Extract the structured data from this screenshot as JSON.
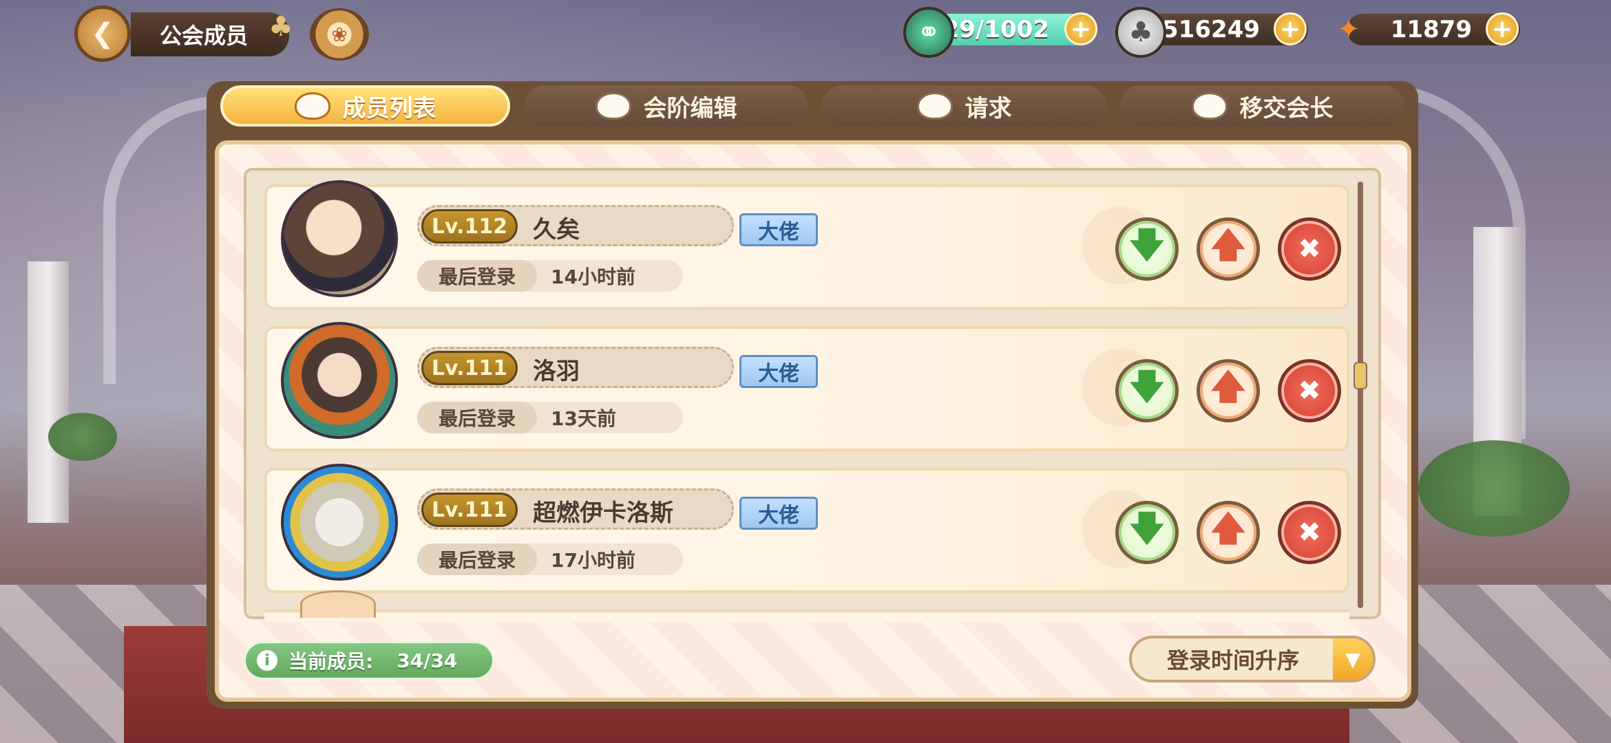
{
  "header": {
    "title": "公会成员",
    "back_icon": "back-arrow-icon",
    "emblem_icon": "guild-emblem-icon"
  },
  "resources": [
    {
      "icon": "potion-icon",
      "value": "29/1002"
    },
    {
      "icon": "clover-coin-icon",
      "value": "6516249"
    },
    {
      "icon": "carrot-icon",
      "value": "11879"
    }
  ],
  "tabs": [
    {
      "label": "成员列表",
      "active": true
    },
    {
      "label": "会阶编辑",
      "active": false
    },
    {
      "label": "请求",
      "active": false
    },
    {
      "label": "移交会长",
      "active": false
    }
  ],
  "members": [
    {
      "level": "Lv.112",
      "name": "久矣",
      "rank": "大佬",
      "login_label": "最后登录",
      "login_time": "14小时前"
    },
    {
      "level": "Lv.111",
      "name": "洛羽",
      "rank": "大佬",
      "login_label": "最后登录",
      "login_time": "13天前"
    },
    {
      "level": "Lv.111",
      "name": "超燃伊卡洛斯",
      "rank": "大佬",
      "login_label": "最后登录",
      "login_time": "17小时前"
    }
  ],
  "footer": {
    "member_count_label": "当前成员:",
    "member_count": "34/34",
    "sort_label": "登录时间升序"
  },
  "colors": {
    "tab_active": "#f4b440",
    "rank_badge": "#9fc7f2",
    "demote": "#3fa33a",
    "promote": "#e05a3c",
    "kick": "#d23e30",
    "member_count_bg": "#62a95f"
  }
}
